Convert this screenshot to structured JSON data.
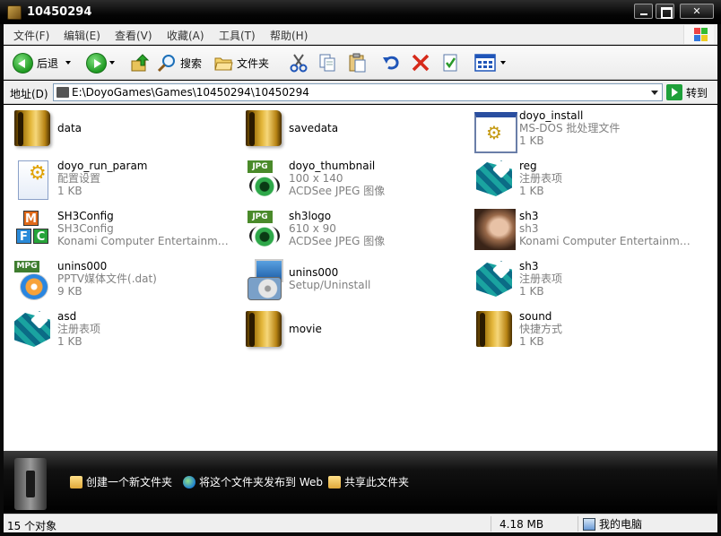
{
  "window": {
    "title": "10450294"
  },
  "menu": {
    "items": [
      "文件(F)",
      "编辑(E)",
      "查看(V)",
      "收藏(A)",
      "工具(T)",
      "帮助(H)"
    ]
  },
  "toolbar": {
    "back_label": "后退",
    "search_label": "搜索",
    "folders_label": "文件夹"
  },
  "address": {
    "label": "地址(D)",
    "path": "E:\\DoyoGames\\Games\\10450294\\10450294",
    "go_label": "转到"
  },
  "files": [
    {
      "name": "data",
      "lines": [],
      "icon": "folder-icon"
    },
    {
      "name": "savedata",
      "lines": [],
      "icon": "folder-icon"
    },
    {
      "name": "doyo_install",
      "lines": [
        "MS-DOS 批处理文件",
        "1 KB"
      ],
      "icon": "batch-file-icon"
    },
    {
      "name": "doyo_run_param",
      "lines": [
        "配置设置",
        "1 KB"
      ],
      "icon": "config-file-icon"
    },
    {
      "name": "doyo_thumbnail",
      "lines": [
        "100 x 140",
        "ACDSee JPEG 图像"
      ],
      "icon": "jpeg-image-icon"
    },
    {
      "name": "reg",
      "lines": [
        "注册表项",
        "1 KB"
      ],
      "icon": "registry-file-icon"
    },
    {
      "name": "SH3Config",
      "lines": [
        "SH3Config",
        "Konami Computer Entertainment ..."
      ],
      "icon": "mfc-app-icon"
    },
    {
      "name": "sh3logo",
      "lines": [
        "610 x 90",
        "ACDSee JPEG 图像"
      ],
      "icon": "jpeg-image-icon"
    },
    {
      "name": "sh3",
      "lines": [
        "sh3",
        "Konami Computer Entertainment ..."
      ],
      "icon": "game-exe-icon"
    },
    {
      "name": "unins000",
      "lines": [
        "PPTV媒体文件(.dat)",
        "9 KB"
      ],
      "icon": "media-file-icon"
    },
    {
      "name": "unins000",
      "lines": [
        "Setup/Uninstall"
      ],
      "icon": "setup-icon"
    },
    {
      "name": "sh3",
      "lines": [
        "注册表项",
        "1 KB"
      ],
      "icon": "registry-file-icon"
    },
    {
      "name": "asd",
      "lines": [
        "注册表项",
        "1 KB"
      ],
      "icon": "registry-file-icon"
    },
    {
      "name": "movie",
      "lines": [],
      "icon": "folder-icon"
    },
    {
      "name": "sound",
      "lines": [
        "快捷方式",
        "1 KB"
      ],
      "icon": "shortcut-folder-icon"
    }
  ],
  "tasks": {
    "new_folder": "创建一个新文件夹",
    "publish_web": "将这个文件夹发布到 Web",
    "share": "共享此文件夹"
  },
  "status": {
    "object_count": "15 个对象",
    "total_size": "4.18 MB",
    "location": "我的电脑"
  }
}
